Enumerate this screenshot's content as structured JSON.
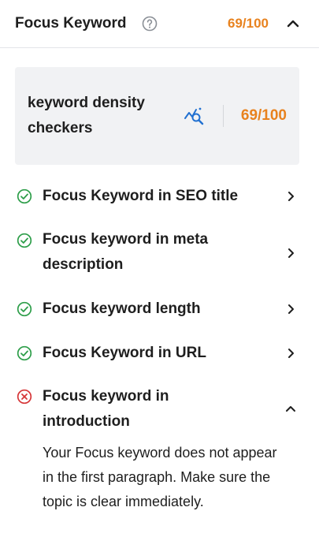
{
  "header": {
    "title": "Focus Keyword",
    "score": "69/100",
    "help_icon": "question-circle-icon",
    "toggle_icon": "chevron-up-icon"
  },
  "keyword_box": {
    "keyword": "keyword density checkers",
    "tool_icon": "keyword-density-icon",
    "score": "69/100"
  },
  "checks": [
    {
      "label": "Focus Keyword in SEO title",
      "status": "pass",
      "icon": "check-circle-icon",
      "expanded": false
    },
    {
      "label": "Focus keyword in meta description",
      "status": "pass",
      "icon": "check-circle-icon",
      "expanded": false
    },
    {
      "label": "Focus keyword length",
      "status": "pass",
      "icon": "check-circle-icon",
      "expanded": false
    },
    {
      "label": "Focus Keyword in URL",
      "status": "pass",
      "icon": "check-circle-icon",
      "expanded": false
    },
    {
      "label": "Focus keyword in introduction",
      "status": "fail",
      "icon": "x-circle-icon",
      "expanded": true,
      "detail": "Your Focus keyword does not appear in the first paragraph. Make sure the topic is clear immediately."
    }
  ],
  "colors": {
    "score": "#e8821e",
    "pass": "#2e9e4a",
    "fail": "#d63638",
    "accent": "#2271d1",
    "box_bg": "#f1f2f4"
  }
}
